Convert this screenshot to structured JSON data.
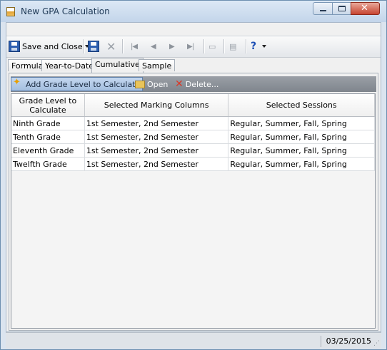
{
  "window": {
    "title": "New GPA Calculation"
  },
  "toolbar": {
    "save_close_label": "Save and Close",
    "help_label": "?"
  },
  "tabs": [
    {
      "label": "Formula"
    },
    {
      "label": "Year-to-Date"
    },
    {
      "label": "Cumulative"
    },
    {
      "label": "Sample"
    }
  ],
  "actions": {
    "add_label": "Add Grade Level to Calculate",
    "open_label": "Open",
    "delete_label": "Delete..."
  },
  "table": {
    "columns": [
      "Grade Level to Calculate",
      "Selected Marking Columns",
      "Selected Sessions"
    ],
    "rows": [
      [
        "Ninth Grade",
        "1st Semester, 2nd Semester",
        "Regular, Summer, Fall, Spring"
      ],
      [
        "Tenth Grade",
        "1st Semester, 2nd Semester",
        "Regular, Summer, Fall, Spring"
      ],
      [
        "Eleventh Grade",
        "1st Semester, 2nd Semester",
        "Regular, Summer, Fall, Spring"
      ],
      [
        "Twelfth Grade",
        "1st Semester, 2nd Semester",
        "Regular, Summer, Fall, Spring"
      ]
    ]
  },
  "status": {
    "date": "03/25/2015"
  },
  "icons": {
    "app": "app-icon",
    "save": "save-icon",
    "delete": "close-icon",
    "first": "first-record-icon",
    "previous": "previous-record-icon",
    "next": "next-record-icon",
    "last": "last-record-icon",
    "print": "print-icon",
    "properties": "properties-icon",
    "help": "help-icon",
    "add": "add-icon",
    "open": "folder-icon",
    "remove": "delete-icon"
  },
  "colors": {
    "titlebar": "#c3d5ea",
    "close_button": "#c74430",
    "action_bar": "#8b9097"
  }
}
